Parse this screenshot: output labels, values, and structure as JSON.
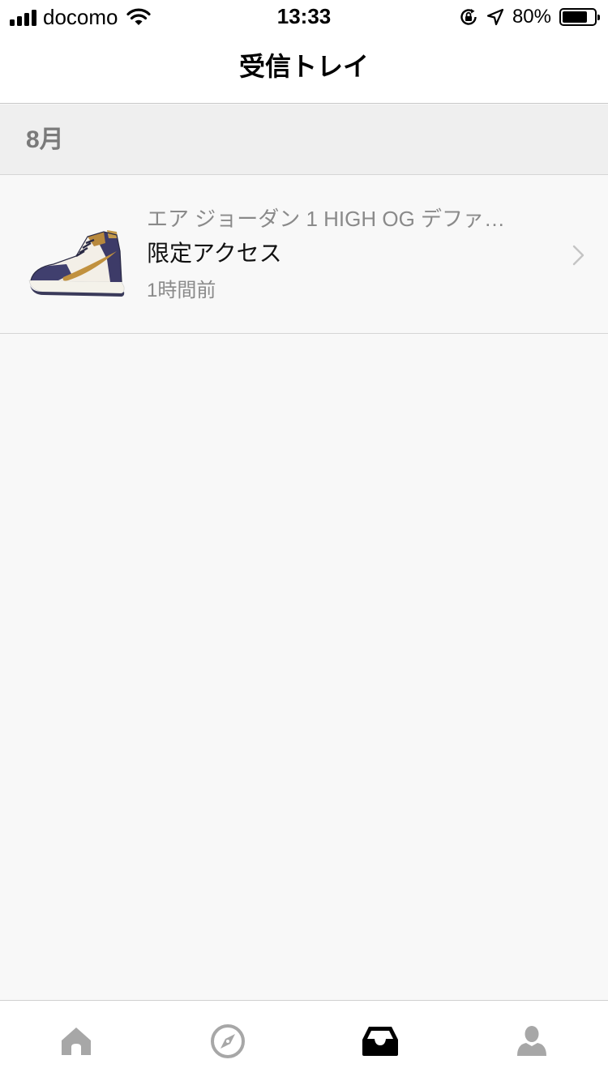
{
  "status_bar": {
    "carrier": "docomo",
    "time": "13:33",
    "battery": "80%",
    "battery_level": 0.8
  },
  "header": {
    "title": "受信トレイ"
  },
  "sections": [
    {
      "label": "8月",
      "items": [
        {
          "product_name": "エア ジョーダン 1 HIGH OG デファ…",
          "title": "限定アクセス",
          "time_ago": "1時間前"
        }
      ]
    }
  ],
  "tab_bar": {
    "tabs": [
      {
        "icon": "home-icon",
        "active": false
      },
      {
        "icon": "compass-icon",
        "active": false
      },
      {
        "icon": "inbox-icon",
        "active": true
      },
      {
        "icon": "profile-icon",
        "active": false
      }
    ]
  },
  "colors": {
    "tab_inactive": "#a7a7a7",
    "tab_active": "#000000",
    "section_bg": "#efefef",
    "page_bg": "#f8f8f8"
  }
}
